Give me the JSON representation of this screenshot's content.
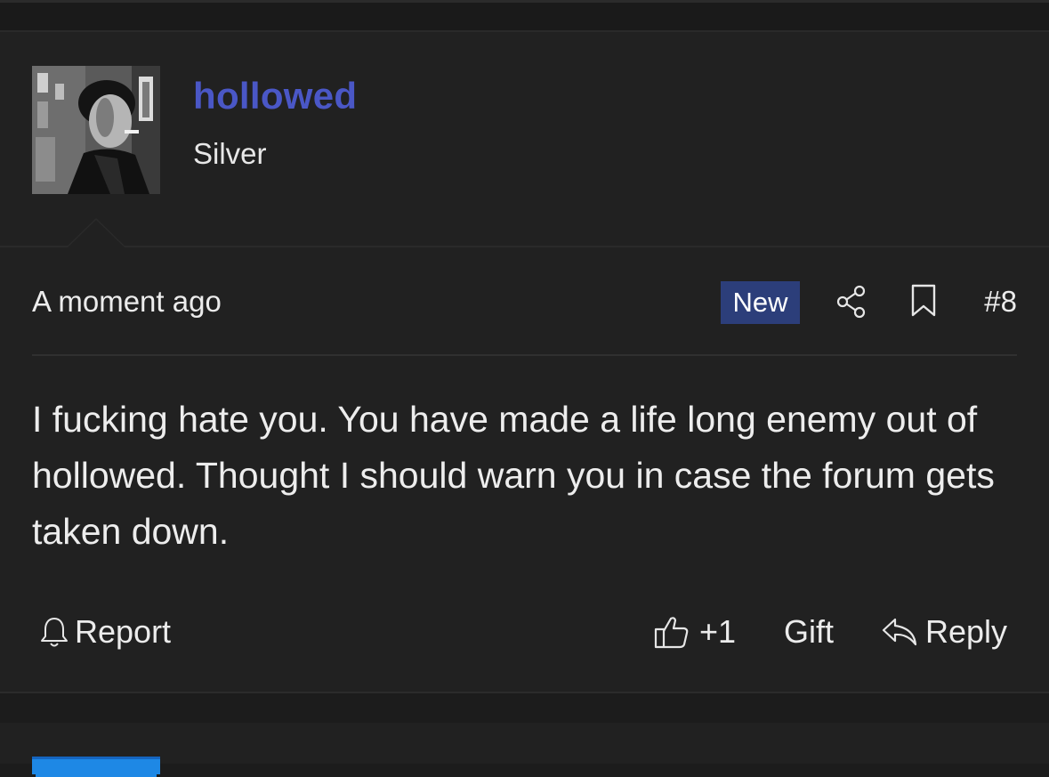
{
  "post": {
    "author": {
      "username": "hollowed",
      "rank": "Silver"
    },
    "timestamp": "A moment ago",
    "new_badge": "New",
    "post_number": "#8",
    "body": "I fucking hate you. You have made a life long enemy out of hollowed. Thought I should warn you in case the forum gets taken down.",
    "actions": {
      "report_label": "Report",
      "like_count": "+1",
      "gift_label": "Gift",
      "reply_label": "Reply"
    }
  },
  "colors": {
    "background": "#212121",
    "username": "#4a57c6",
    "new_badge": "#2c3e7a",
    "text": "#ececec"
  },
  "icons": [
    "share-icon",
    "bookmark-icon",
    "bell-icon",
    "thumbs-up-icon",
    "reply-arrow-icon"
  ]
}
